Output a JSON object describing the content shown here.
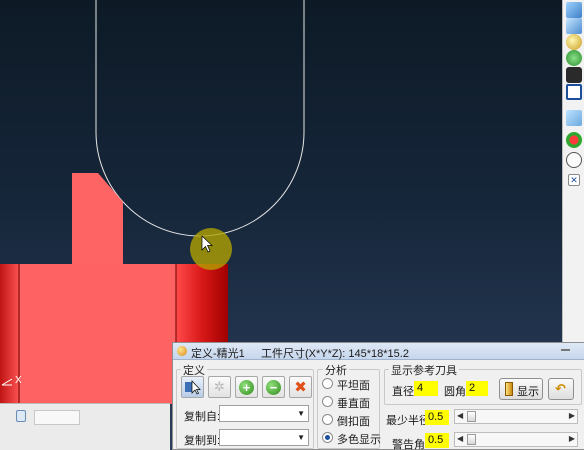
{
  "dialog": {
    "title": "定义-精光1",
    "workpiece_size": "工件尺寸(X*Y*Z): 145*18*15.2",
    "define_group": {
      "label": "定义",
      "copy_from_label": "复制自:",
      "copy_to_label": "复制到:",
      "copy_from_value": "",
      "copy_to_value": ""
    },
    "analysis_group": {
      "label": "分析",
      "options": [
        "平坦面",
        "垂直面",
        "倒扣面",
        "多色显示"
      ],
      "selected": "多色显示"
    },
    "tool_group": {
      "label": "显示参考刀具",
      "diameter_label": "直径",
      "diameter_value": "4",
      "corner_label": "圆角",
      "corner_value": "2",
      "show_button_label": "显示",
      "min_radius_label": "最少半径",
      "min_radius_value": "0.5",
      "warning_angle_label": "警告角",
      "warning_angle_value": "0.5"
    }
  },
  "axis_label_x": "X",
  "colors": {
    "part_red": "#ff6262",
    "part_dark_red": "#c81010",
    "highlight_yellow": "#ffff00",
    "cursor_halo": "#b8a800"
  },
  "icons": {
    "right_toolbar": [
      "cube-icon",
      "view-cube-icon",
      "zoom-icon",
      "rotate-icon",
      "fit-icon",
      "box-view-icon",
      "solid-icon",
      "color-ball-icon",
      "globe-icon",
      "close-x-icon"
    ]
  }
}
